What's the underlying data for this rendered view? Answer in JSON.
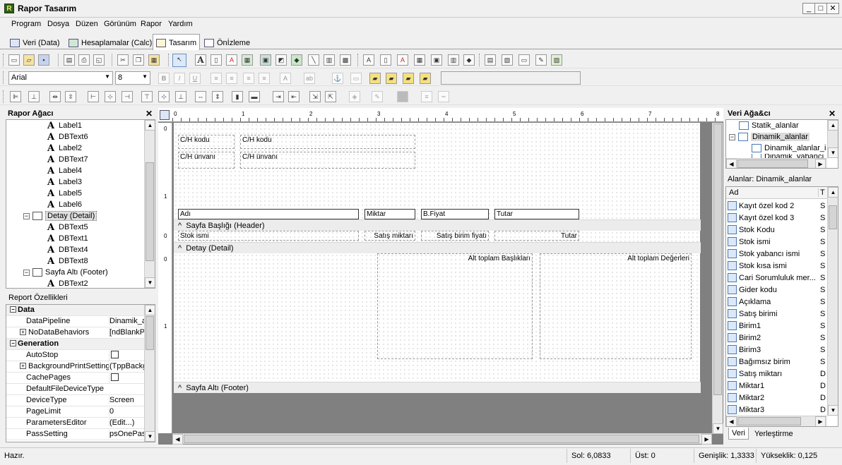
{
  "window": {
    "title": "Rapor Tasarım",
    "icon_letter": "R"
  },
  "menu": [
    "Program",
    "Dosya",
    "Düzen",
    "Görünüm",
    "Rapor",
    "Yardım"
  ],
  "tabs": [
    {
      "label": "Veri (Data)",
      "icon": "data-icon"
    },
    {
      "label": "Hesaplamalar (Calc)",
      "icon": "calc-icon"
    },
    {
      "label": "Tasarım",
      "icon": "design-icon",
      "active": true
    },
    {
      "label": "Önİzleme",
      "icon": "preview-icon"
    }
  ],
  "font_toolbar": {
    "font": "Arial",
    "size": "8"
  },
  "report_tree": {
    "title": "Rapor Ağacı",
    "items": [
      "Label1",
      "DBText6",
      "Label2",
      "DBText7",
      "Label4",
      "Label3",
      "Label5",
      "Label6",
      "Detay (Detail)",
      "DBText5",
      "DBText1",
      "DBText4",
      "DBText8",
      "Sayfa Altı (Footer)",
      "DBText2"
    ]
  },
  "properties": {
    "title": "Report Özellikleri",
    "rows": [
      {
        "type": "cat",
        "name": "Data"
      },
      {
        "name": "DataPipeline",
        "value": "Dinamik_alanlar"
      },
      {
        "name": "NoDataBehaviors",
        "value": "[ndBlankPage]",
        "expand": "+"
      },
      {
        "type": "cat",
        "name": "Generation"
      },
      {
        "name": "AutoStop",
        "value": "",
        "check": true
      },
      {
        "name": "BackgroundPrintSettings",
        "value": "(TppBackground",
        "expand": "+"
      },
      {
        "name": "CachePages",
        "value": "",
        "check": true
      },
      {
        "name": "DefaultFileDeviceType",
        "value": ""
      },
      {
        "name": "DeviceType",
        "value": "Screen"
      },
      {
        "name": "PageLimit",
        "value": "0"
      },
      {
        "name": "ParametersEditor",
        "value": "(Edit...)"
      },
      {
        "name": "PassSetting",
        "value": "psOnePass"
      }
    ]
  },
  "ruler": {
    "marks": [
      "0",
      "1",
      "2",
      "3",
      "4",
      "5",
      "6",
      "7",
      "8"
    ]
  },
  "design": {
    "title_labels": [
      "C/H kodu",
      "C/H kodu",
      "C/H ünvanı",
      "C/H ünvanı"
    ],
    "column_headers": [
      "Adı",
      "Miktar",
      "B.Fiyat",
      "Tutar"
    ],
    "header_band": "Sayfa Başlığı (Header)",
    "detail_fields": [
      "Stok ismi",
      "Satış miktarı",
      "Satış birim fiyatı",
      "Tutar"
    ],
    "detail_band": "Detay (Detail)",
    "subtotal_labels": "Alt toplam Başlıkları",
    "subtotal_values": "Alt toplam Değerleri",
    "footer_band": "Sayfa Altı (Footer)",
    "vruler": [
      "0",
      "1",
      "0",
      "0",
      "1"
    ]
  },
  "data_tree": {
    "title": "Veri Ağa&cı",
    "items": [
      "Statik_alanlar",
      "Dinamik_alanlar",
      "Dinamik_alanlar_i",
      "Dinamik_yabancı"
    ]
  },
  "fields": {
    "title": "Alanlar: Dinamik_alanlar",
    "col_name": "Ad",
    "col_type": "T",
    "rows": [
      {
        "name": "Kayıt özel kod 2",
        "type": "S"
      },
      {
        "name": "Kayıt özel kod 3",
        "type": "S"
      },
      {
        "name": "Stok Kodu",
        "type": "S"
      },
      {
        "name": "Stok ismi",
        "type": "S"
      },
      {
        "name": "Stok yabancı ismi",
        "type": "S"
      },
      {
        "name": "Stok kısa ismi",
        "type": "S"
      },
      {
        "name": "Cari Sorumluluk mer...",
        "type": "S"
      },
      {
        "name": "Gider kodu",
        "type": "S"
      },
      {
        "name": "Açıklama",
        "type": "S"
      },
      {
        "name": "Satış birimi",
        "type": "S"
      },
      {
        "name": "Birim1",
        "type": "S"
      },
      {
        "name": "Birim2",
        "type": "S"
      },
      {
        "name": "Birim3",
        "type": "S"
      },
      {
        "name": "Bağımsız birim",
        "type": "S"
      },
      {
        "name": "Satış miktarı",
        "type": "D"
      },
      {
        "name": "Miktar1",
        "type": "D"
      },
      {
        "name": "Miktar2",
        "type": "D"
      },
      {
        "name": "Miktar3",
        "type": "D"
      }
    ],
    "tabs": [
      "Veri",
      "Yerleştirme"
    ]
  },
  "status": {
    "ready": "Hazır.",
    "left": "Sol: 6,0833",
    "top": "Üst: 0",
    "width": "Genişlik: 1,3333",
    "height": "Yükseklik: 0,125"
  }
}
